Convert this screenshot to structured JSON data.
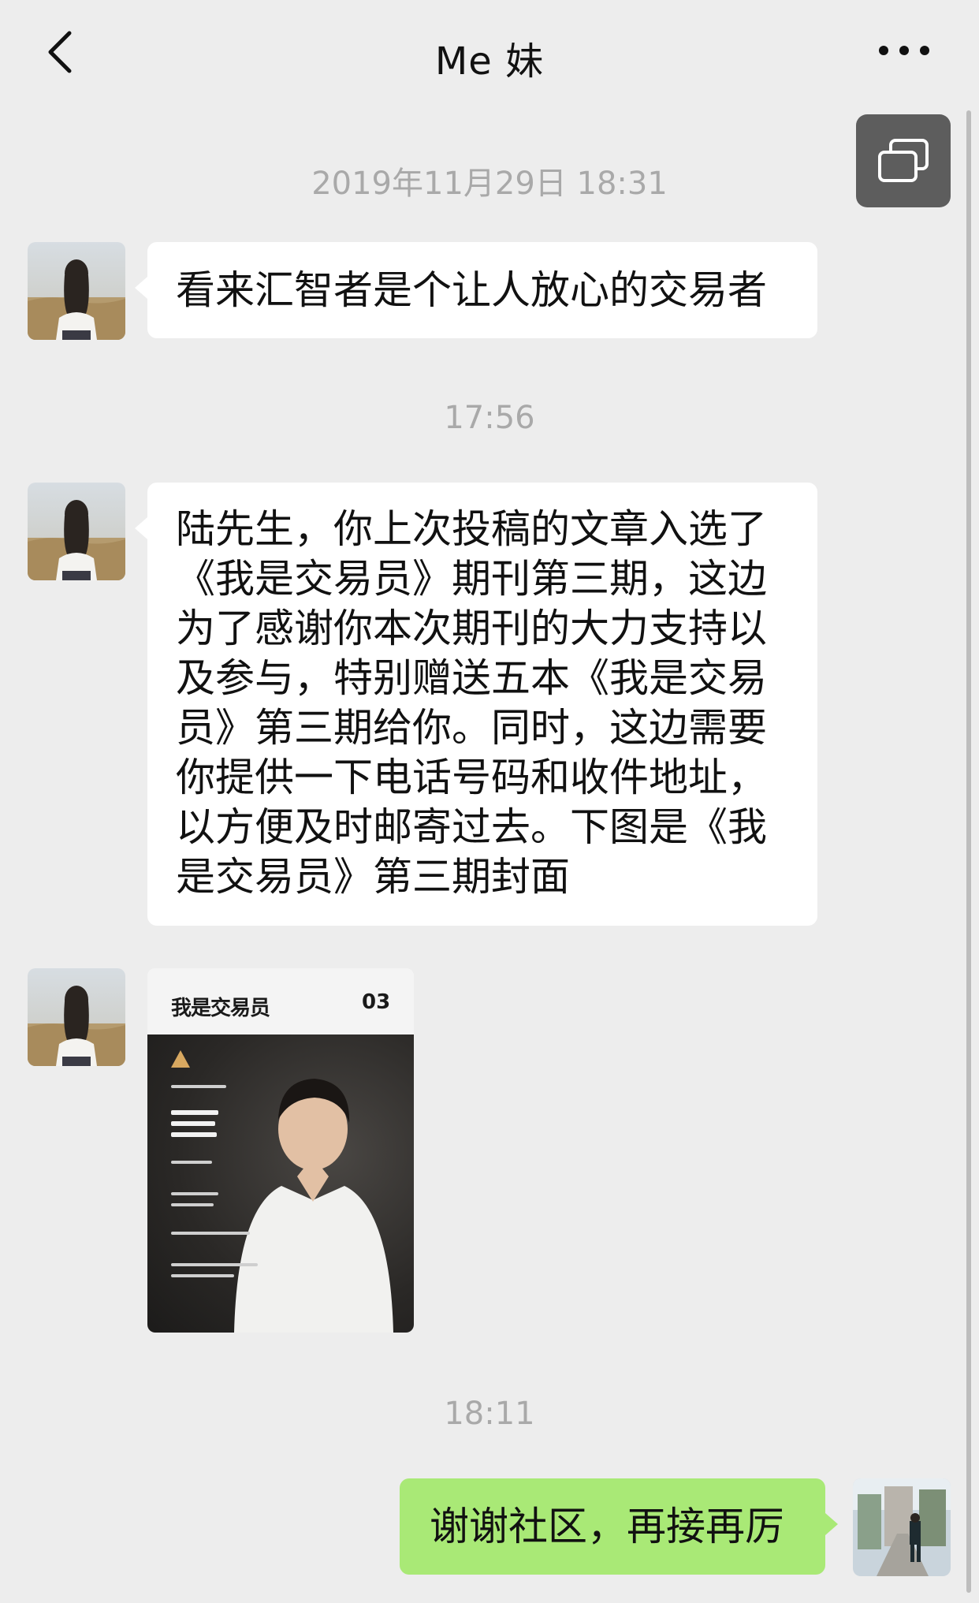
{
  "nav": {
    "title": "Me 妹"
  },
  "messages": {
    "ts1": "2019年11月29日 18:31",
    "msg1": "看来汇智者是个让人放心的交易者",
    "ts2": "17:56",
    "msg2_lines": [
      "陆先生，你上次投稿的文章入选了",
      "《我是交易员》期刊第三期，这边",
      "为了感谢你本次期刊的大力支持以",
      "及参与，特别赠送五本《我是交易",
      "员》第三期给你。同时，这边需要",
      "你提供一下电话号码和收件地址，",
      "以方便及时邮寄过去。下图是《我",
      "是交易员》第三期封面"
    ],
    "cover": {
      "brand": "我是交易员",
      "issue": "03"
    },
    "ts3": "18:11",
    "msg_out": "谢谢社区，再接再厉"
  },
  "colors": {
    "background": "#ededed",
    "incoming_bubble": "#ffffff",
    "outgoing_bubble": "#a9e976",
    "timestamp": "#a9a9a9"
  },
  "icons": {
    "back": "chevron-left-icon",
    "more": "more-dots-icon",
    "floating_window": "floating-window-icon"
  }
}
